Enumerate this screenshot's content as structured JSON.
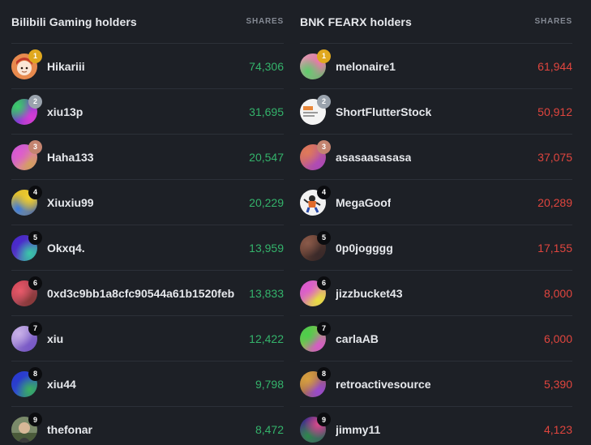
{
  "left": {
    "title": "Bilibili Gaming holders",
    "column_label": "SHARES",
    "value_color": "#34b36b",
    "holders": [
      {
        "rank": "1",
        "name": "Hikariii",
        "shares": "74,306",
        "avatar": "illustrated-character"
      },
      {
        "rank": "2",
        "name": "xiu13p",
        "shares": "31,695",
        "avatar": "gradient"
      },
      {
        "rank": "3",
        "name": "Haha133",
        "shares": "20,547",
        "avatar": "gradient"
      },
      {
        "rank": "4",
        "name": "Xiuxiu99",
        "shares": "20,229",
        "avatar": "gradient"
      },
      {
        "rank": "5",
        "name": "Okxq4.",
        "shares": "13,959",
        "avatar": "gradient"
      },
      {
        "rank": "6",
        "name": "0xd3c9bb1a8cfc90544a61b1520feb",
        "shares": "13,833",
        "avatar": "gradient"
      },
      {
        "rank": "7",
        "name": "xiu",
        "shares": "12,422",
        "avatar": "gradient"
      },
      {
        "rank": "8",
        "name": "xiu44",
        "shares": "9,798",
        "avatar": "gradient"
      },
      {
        "rank": "9",
        "name": "thefonar",
        "shares": "8,472",
        "avatar": "photo"
      }
    ]
  },
  "right": {
    "title": "BNK FEARX holders",
    "column_label": "SHARES",
    "value_color": "#e0453e",
    "holders": [
      {
        "rank": "1",
        "name": "melonaire1",
        "shares": "61,944",
        "avatar": "gradient"
      },
      {
        "rank": "2",
        "name": "ShortFlutterStock",
        "shares": "50,912",
        "avatar": "logo-image"
      },
      {
        "rank": "3",
        "name": "asasaasasasa",
        "shares": "37,075",
        "avatar": "gradient"
      },
      {
        "rank": "4",
        "name": "MegaGoof",
        "shares": "20,289",
        "avatar": "cartoon-character"
      },
      {
        "rank": "5",
        "name": "0p0jogggg",
        "shares": "17,155",
        "avatar": "gradient"
      },
      {
        "rank": "6",
        "name": "jizzbucket43",
        "shares": "8,000",
        "avatar": "gradient"
      },
      {
        "rank": "7",
        "name": "carlaAB",
        "shares": "6,000",
        "avatar": "gradient"
      },
      {
        "rank": "8",
        "name": "retroactivesource",
        "shares": "5,390",
        "avatar": "gradient"
      },
      {
        "rank": "9",
        "name": "jimmy11",
        "shares": "4,123",
        "avatar": "gradient"
      }
    ]
  }
}
